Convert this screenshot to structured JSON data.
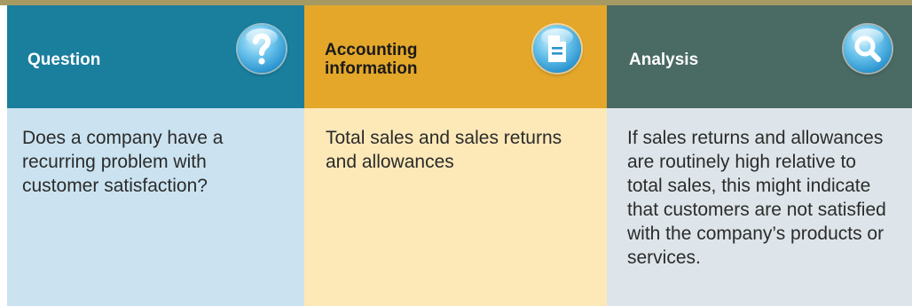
{
  "columns": [
    {
      "header": "Question",
      "icon": "question-mark-icon",
      "body": "Does a company have a recurring problem with customer satisfaction?"
    },
    {
      "header": "Accounting information",
      "icon": "document-icon",
      "body": "Total sales and sales returns and allowances"
    },
    {
      "header": "Analysis",
      "icon": "magnifier-icon",
      "body": "If sales returns and allowances are routinely high relative to total sales, this might indicate that customers are not satisfied with the company’s products or services."
    }
  ],
  "colors": {
    "top_rule": "#a69a62",
    "question_header": "#1a7e9d",
    "question_body": "#cbe3f0",
    "accounting_header": "#e4a72a",
    "accounting_body": "#fde9b8",
    "analysis_header": "#4a6a64",
    "analysis_body": "#dde5ea"
  }
}
